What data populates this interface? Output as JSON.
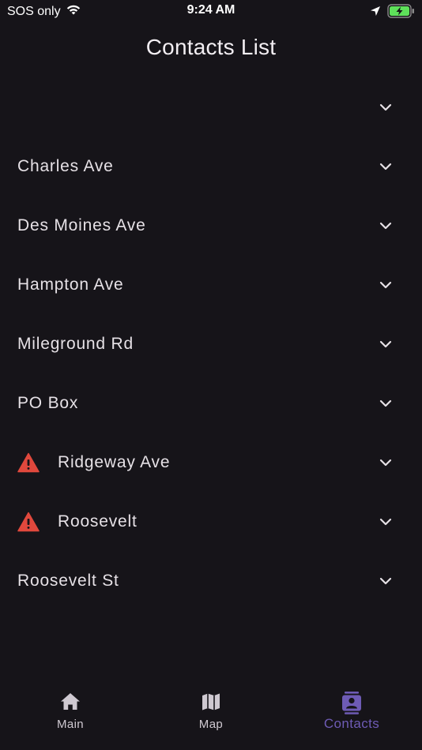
{
  "status_bar": {
    "carrier": "SOS only",
    "time": "9:24 AM"
  },
  "header": {
    "title": "Contacts List"
  },
  "contacts": [
    {
      "label": "",
      "warning": false
    },
    {
      "label": "Charles Ave",
      "warning": false
    },
    {
      "label": "Des Moines Ave",
      "warning": false
    },
    {
      "label": "Hampton Ave",
      "warning": false
    },
    {
      "label": "Mileground Rd",
      "warning": false
    },
    {
      "label": "PO Box",
      "warning": false
    },
    {
      "label": "Ridgeway Ave",
      "warning": true
    },
    {
      "label": "Roosevelt",
      "warning": true
    },
    {
      "label": "Roosevelt St",
      "warning": false
    }
  ],
  "bottom_nav": {
    "items": [
      {
        "label": "Main",
        "icon": "home-icon",
        "active": false
      },
      {
        "label": "Map",
        "icon": "map-icon",
        "active": false
      },
      {
        "label": "Contacts",
        "icon": "contacts-icon",
        "active": true
      }
    ]
  },
  "colors": {
    "background": "#161419",
    "accent": "#6e5bb5",
    "warning": "#e0483d",
    "battery": "#5ee05a"
  }
}
